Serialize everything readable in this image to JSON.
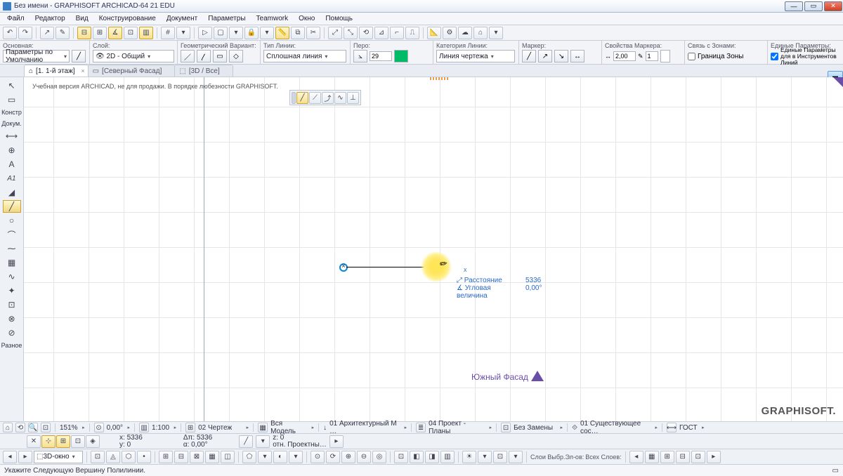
{
  "title": "Без имени - GRAPHISOFT ARCHICAD-64 21 EDU",
  "menu": [
    "Файл",
    "Редактор",
    "Вид",
    "Конструирование",
    "Документ",
    "Параметры",
    "Teamwork",
    "Окно",
    "Помощь"
  ],
  "infobox": {
    "main": {
      "label": "Основная:",
      "value": "Параметры по Умолчанию"
    },
    "layer": {
      "label": "Слой:",
      "value": "2D - Общий",
      "eye": "👁"
    },
    "geom": {
      "label": "Геометрический Вариант:"
    },
    "linetype": {
      "label": "Тип Линии:",
      "value": "Сплошная линия"
    },
    "pen": {
      "label": "Перо:",
      "num": "29"
    },
    "linecat": {
      "label": "Категория Линии:",
      "value": "Линия чертежа"
    },
    "marker": {
      "label": "Маркер:"
    },
    "markerprops": {
      "label": "Свойства Маркера:",
      "val": "2,00",
      "count": "1"
    },
    "zones": {
      "label": "Связь с Зонами:",
      "value": "Граница Зоны"
    },
    "unified": {
      "label": "Единые Параметры:",
      "check": "Единые Параметры для в\nИнструментов Линий"
    }
  },
  "tabs": [
    {
      "icon": "⌂",
      "label": "[1. 1-й этаж]",
      "active": true
    },
    {
      "icon": "▭",
      "label": "[Северный Фасад]",
      "active": false
    },
    {
      "icon": "⬚",
      "label": "[3D / Все]",
      "active": false
    }
  ],
  "edu_note": "Учебная версия ARCHICAD, не для продажи. В порядке любезности GRAPHISOFT.",
  "leftbar": {
    "cat1": "Констр",
    "cat2": "Докум.",
    "cat3": "Разное"
  },
  "tracker": {
    "dist_label": "Расстояние",
    "dist_val": "5336",
    "ang_label": "Угловая величина",
    "ang_val": "0,00°"
  },
  "south_label": "Южный Фасад",
  "watermark": "GRAPHISOFT.",
  "status": {
    "zoom": "151%",
    "angle": "0,00°",
    "scale": "1:100",
    "s1": "02 Чертеж",
    "s2": "Вся Модель",
    "s3": "01 Архитектурный М …",
    "s4": "04 Проект - Планы",
    "s5": "Без Замены",
    "s6": "01 Существующее сос…",
    "s7": "ГОСТ"
  },
  "coords": {
    "x_lbl": "x:",
    "x": "5336",
    "y_lbl": "y:",
    "y": "0",
    "a_lbl": "Δπ:",
    "a": "5336",
    "r_lbl": "α:",
    "r": "0,00°",
    "z_lbl": "z:",
    "z": "0",
    "proj": "отн. Проектны…"
  },
  "bottom": {
    "win": "3D-окно",
    "layers_label": "Слои Выбр.Эл-ов:",
    "layers_val": "Всех Слоев:"
  },
  "hint": "Укажите Следующую Вершину Полилинии."
}
